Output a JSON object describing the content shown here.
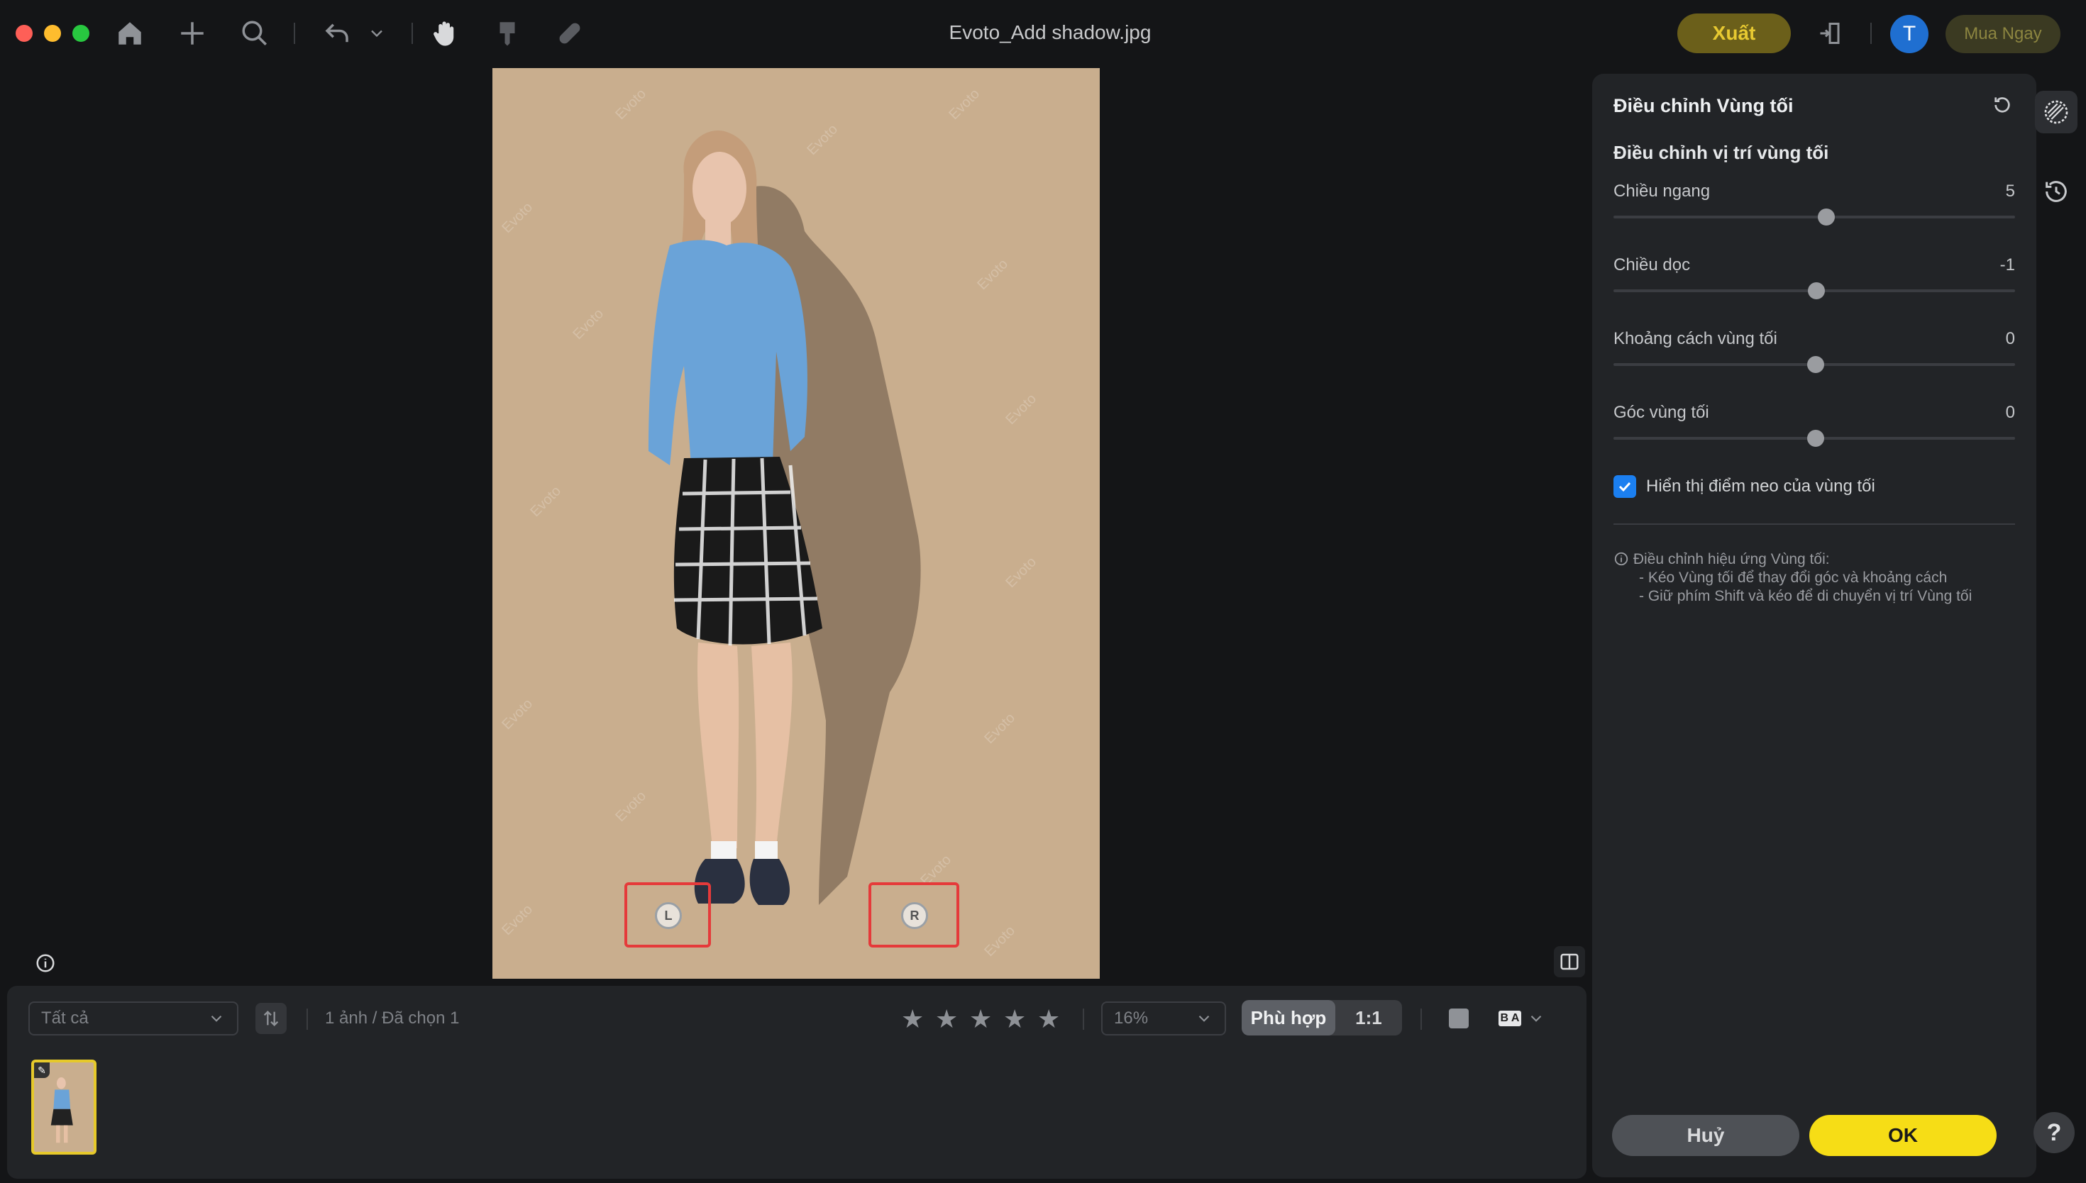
{
  "window": {
    "title": "Evoto_Add shadow.jpg"
  },
  "toolbar": {
    "icons": [
      "home-icon",
      "add-icon",
      "search-icon",
      "undo-icon",
      "chevron-down-icon",
      "hand-icon",
      "brush-icon",
      "bandage-icon"
    ],
    "export_label": "Xuất",
    "avatar_initial": "T",
    "buy_label": "Mua Ngay"
  },
  "canvas": {
    "watermark": "Evoto",
    "anchor_left": "L",
    "anchor_right": "R"
  },
  "bottom": {
    "filter_value": "Tất cả",
    "count_text": "1 ảnh / Đã chọn 1",
    "zoom_value": "16%",
    "fit_label": "Phù hợp",
    "one_to_one_label": "1:1",
    "compare_label": "B A",
    "rating_stars": 5
  },
  "panel": {
    "title": "Điều chỉnh Vùng tối",
    "section_title": "Điều chỉnh vị trí vùng tối",
    "sliders": [
      {
        "label": "Chiều ngang",
        "value": "5",
        "fraction": 0.53
      },
      {
        "label": "Chiều dọc",
        "value": "-1",
        "fraction": 0.505
      },
      {
        "label": "Khoảng cách vùng tối",
        "value": "0",
        "fraction": 0.503
      },
      {
        "label": "Góc vùng tối",
        "value": "0",
        "fraction": 0.503
      }
    ],
    "checkbox_label": "Hiển thị điểm neo của vùng tối",
    "info_title": "Điều chỉnh hiệu ứng Vùng tối:",
    "info_line1": "- Kéo Vùng tối để thay đổi góc và khoảng cách",
    "info_line2": "- Giữ phím Shift và kéo để di chuyển vị trí Vùng tối",
    "cancel_label": "Huỷ",
    "ok_label": "OK"
  },
  "help_label": "?",
  "colors": {
    "accent_yellow": "#f6dd16",
    "anchor_highlight": "#e53a3a",
    "background_beige": "#c9ae8e"
  }
}
